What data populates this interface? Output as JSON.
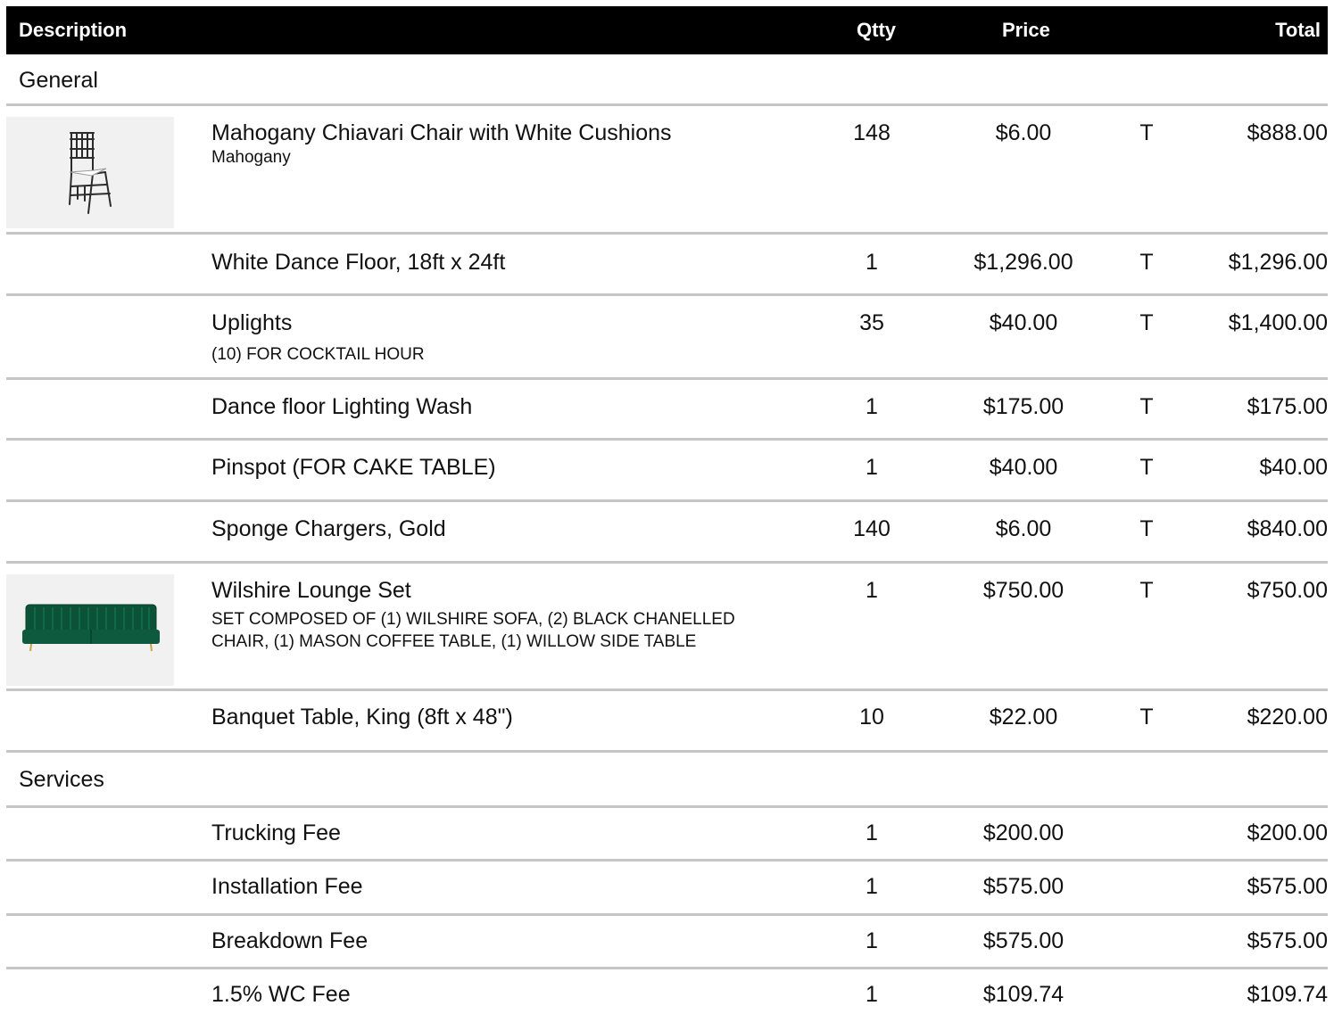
{
  "header": {
    "description": "Description",
    "qty": "Qtty",
    "price": "Price",
    "total": "Total"
  },
  "sections": [
    {
      "title": "General",
      "items": [
        {
          "name": "Mahogany Chiavari Chair with White Cushions",
          "sub": "Mahogany",
          "qty": "148",
          "price": "$6.00",
          "tax": "T",
          "total": "$888.00",
          "image": "chair-image"
        },
        {
          "name": "White Dance Floor, 18ft x 24ft",
          "sub": "",
          "qty": "1",
          "price": "$1,296.00",
          "tax": "T",
          "total": "$1,296.00"
        },
        {
          "name": "Uplights",
          "sub": "(10) FOR COCKTAIL HOUR",
          "qty": "35",
          "price": "$40.00",
          "tax": "T",
          "total": "$1,400.00"
        },
        {
          "name": "Dance floor Lighting Wash",
          "sub": "",
          "qty": "1",
          "price": "$175.00",
          "tax": "T",
          "total": "$175.00"
        },
        {
          "name": "Pinspot (FOR CAKE TABLE)",
          "sub": "",
          "qty": "1",
          "price": "$40.00",
          "tax": "T",
          "total": "$40.00"
        },
        {
          "name": "Sponge Chargers, Gold",
          "sub": "",
          "qty": "140",
          "price": "$6.00",
          "tax": "T",
          "total": "$840.00"
        },
        {
          "name": "Wilshire Lounge Set",
          "sub": "SET COMPOSED OF (1) WILSHIRE SOFA, (2) BLACK CHANELLED CHAIR, (1) MASON COFFEE TABLE, (1) WILLOW SIDE TABLE",
          "qty": "1",
          "price": "$750.00",
          "tax": "T",
          "total": "$750.00",
          "image": "sofa-image"
        },
        {
          "name": "Banquet Table, King (8ft x 48\")",
          "sub": "",
          "qty": "10",
          "price": "$22.00",
          "tax": "T",
          "total": "$220.00"
        }
      ]
    },
    {
      "title": "Services",
      "items": [
        {
          "name": "Trucking Fee",
          "sub": "",
          "qty": "1",
          "price": "$200.00",
          "tax": "",
          "total": "$200.00"
        },
        {
          "name": "Installation Fee",
          "sub": "",
          "qty": "1",
          "price": "$575.00",
          "tax": "",
          "total": "$575.00"
        },
        {
          "name": "Breakdown Fee",
          "sub": "",
          "qty": "1",
          "price": "$575.00",
          "tax": "",
          "total": "$575.00"
        },
        {
          "name": "1.5% WC Fee",
          "sub": "",
          "qty": "1",
          "price": "$109.74",
          "tax": "",
          "total": "$109.74"
        }
      ]
    }
  ],
  "colors": {
    "header_bg": "#000000",
    "divider": "#c6c6c6",
    "sofa_green": "#0d5a3e"
  }
}
